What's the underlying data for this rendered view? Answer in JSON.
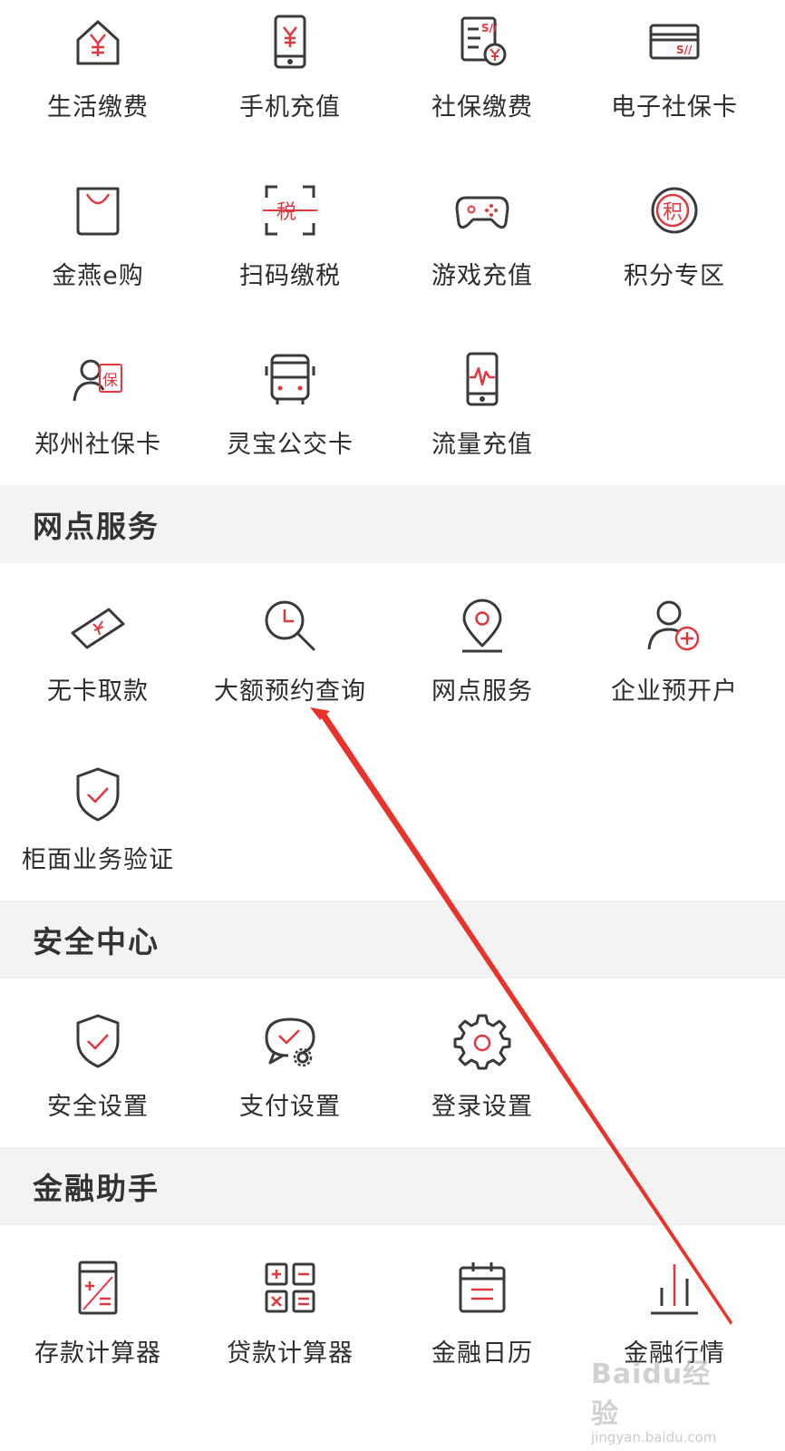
{
  "colors": {
    "accent": "#e0383e",
    "icon_stroke": "#3a3a3a",
    "section_bg": "#f3f3f3",
    "annotation_arrow": "#e8322a"
  },
  "top_services": [
    {
      "label": "生活缴费",
      "icon": "house-yen-icon"
    },
    {
      "label": "手机充值",
      "icon": "phone-yen-icon"
    },
    {
      "label": "社保缴费",
      "icon": "document-yen-icon"
    },
    {
      "label": "电子社保卡",
      "icon": "card-icon"
    },
    {
      "label": "金燕e购",
      "icon": "shopping-bag-icon"
    },
    {
      "label": "扫码缴税",
      "icon": "scan-tax-icon"
    },
    {
      "label": "游戏充值",
      "icon": "gamepad-icon"
    },
    {
      "label": "积分专区",
      "icon": "points-coin-icon"
    },
    {
      "label": "郑州社保卡",
      "icon": "person-insurance-card-icon"
    },
    {
      "label": "灵宝公交卡",
      "icon": "bus-icon"
    },
    {
      "label": "流量充值",
      "icon": "phone-signal-icon"
    }
  ],
  "sections": {
    "branch": {
      "title": "网点服务",
      "items": [
        {
          "label": "无卡取款",
          "icon": "cash-ticket-icon"
        },
        {
          "label": "大额预约查询",
          "icon": "clock-search-icon"
        },
        {
          "label": "网点服务",
          "icon": "location-pin-icon"
        },
        {
          "label": "企业预开户",
          "icon": "user-add-icon"
        },
        {
          "label": "柜面业务验证",
          "icon": "shield-check-icon"
        }
      ]
    },
    "security": {
      "title": "安全中心",
      "items": [
        {
          "label": "安全设置",
          "icon": "shield-check-icon"
        },
        {
          "label": "支付设置",
          "icon": "chat-check-gear-icon"
        },
        {
          "label": "登录设置",
          "icon": "gear-icon"
        }
      ]
    },
    "finance": {
      "title": "金融助手",
      "items": [
        {
          "label": "存款计算器",
          "icon": "calculator-icon"
        },
        {
          "label": "贷款计算器",
          "icon": "grid-calculator-icon"
        },
        {
          "label": "金融日历",
          "icon": "calendar-icon"
        },
        {
          "label": "金融行情",
          "icon": "bar-chart-icon"
        }
      ]
    }
  },
  "watermark": {
    "logo": "Baidu经验",
    "sub": "jingyan.baidu.com"
  }
}
